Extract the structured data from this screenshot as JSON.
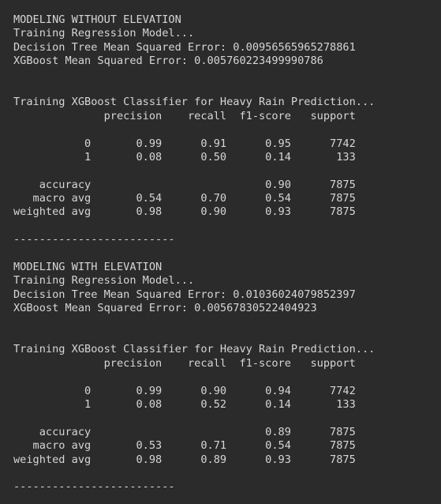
{
  "output": {
    "section1": {
      "header": "MODELING WITHOUT ELEVATION",
      "training_regression": "Training Regression Model...",
      "dt_mse": "Decision Tree Mean Squared Error: 0.00956565965278861",
      "xgb_mse": "XGBoost Mean Squared Error: 0.005760223499990786",
      "classifier_title": "Training XGBoost Classifier for Heavy Rain Prediction...",
      "report_header": "              precision    recall  f1-score   support",
      "row_0": "           0       0.99      0.91      0.95      7742",
      "row_1": "           1       0.08      0.50      0.14       133",
      "accuracy": "    accuracy                           0.90      7875",
      "macro_avg": "   macro avg       0.54      0.70      0.54      7875",
      "weighted_avg": "weighted avg       0.98      0.90      0.93      7875",
      "separator": "-------------------------"
    },
    "section2": {
      "header": "MODELING WITH ELEVATION",
      "training_regression": "Training Regression Model...",
      "dt_mse": "Decision Tree Mean Squared Error: 0.01036024079852397",
      "xgb_mse": "XGBoost Mean Squared Error: 0.00567830522404923",
      "classifier_title": "Training XGBoost Classifier for Heavy Rain Prediction...",
      "report_header": "              precision    recall  f1-score   support",
      "row_0": "           0       0.99      0.90      0.94      7742",
      "row_1": "           1       0.08      0.52      0.14       133",
      "accuracy": "    accuracy                           0.89      7875",
      "macro_avg": "   macro avg       0.53      0.71      0.54      7875",
      "weighted_avg": "weighted avg       0.98      0.89      0.93      7875",
      "separator": "-------------------------"
    }
  },
  "colors": {
    "background": "#2b2b2b",
    "text": "#d6d6d6"
  }
}
